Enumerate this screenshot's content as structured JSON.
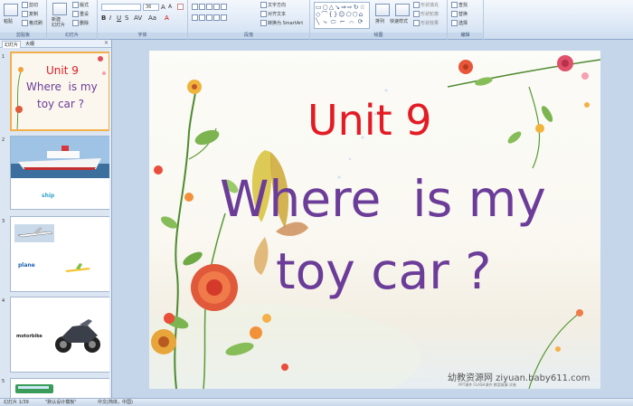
{
  "ribbon": {
    "clipboard": {
      "label": "剪贴板",
      "paste": "粘贴",
      "cut": "剪切",
      "copy": "复制",
      "painter": "格式刷"
    },
    "slides": {
      "label": "幻灯片",
      "new_slide": "新建\n幻灯片",
      "layout": "版式",
      "reset": "重设",
      "delete": "删除"
    },
    "font": {
      "label": "字体",
      "font_name": "",
      "font_size": "36"
    },
    "paragraph": {
      "label": "段落",
      "text_direction": "文字方向",
      "align_text": "对齐文本",
      "smartart": "转换为 SmartArt"
    },
    "drawing": {
      "label": "绘图",
      "arrange": "排列",
      "quick_styles": "快速样式",
      "fill": "形状填充",
      "outline": "形状轮廓",
      "effects": "形状效果"
    },
    "editing": {
      "label": "编辑",
      "find": "查找",
      "replace": "替换",
      "select": "选择"
    }
  },
  "panel": {
    "tab_slides": "幻灯片",
    "tab_outline": "大纲",
    "close": "×"
  },
  "thumbnails": [
    {
      "num": "1",
      "line1": "Unit 9",
      "line2": "Where  is my",
      "line3": "toy car ?"
    },
    {
      "num": "2",
      "caption": "ship"
    },
    {
      "num": "3",
      "caption": "plane"
    },
    {
      "num": "4",
      "caption": "motorbike"
    },
    {
      "num": "5"
    }
  ],
  "slide": {
    "title": "Unit 9",
    "line1": "Where  is my",
    "line2": "toy car ?",
    "watermark": "幼教资源网 ziyuan.baby611.com",
    "watermark_small": "PPT课件  FLASH课件  教案故事  试卷"
  },
  "status": {
    "slide_count": "幻灯片 1/39",
    "theme": "\"默认设计模板\"",
    "language": "中文(简体，中国)"
  },
  "colors": {
    "title_red": "#e31b24",
    "text_purple": "#6b3d99",
    "selected_border": "#f3b04a"
  }
}
